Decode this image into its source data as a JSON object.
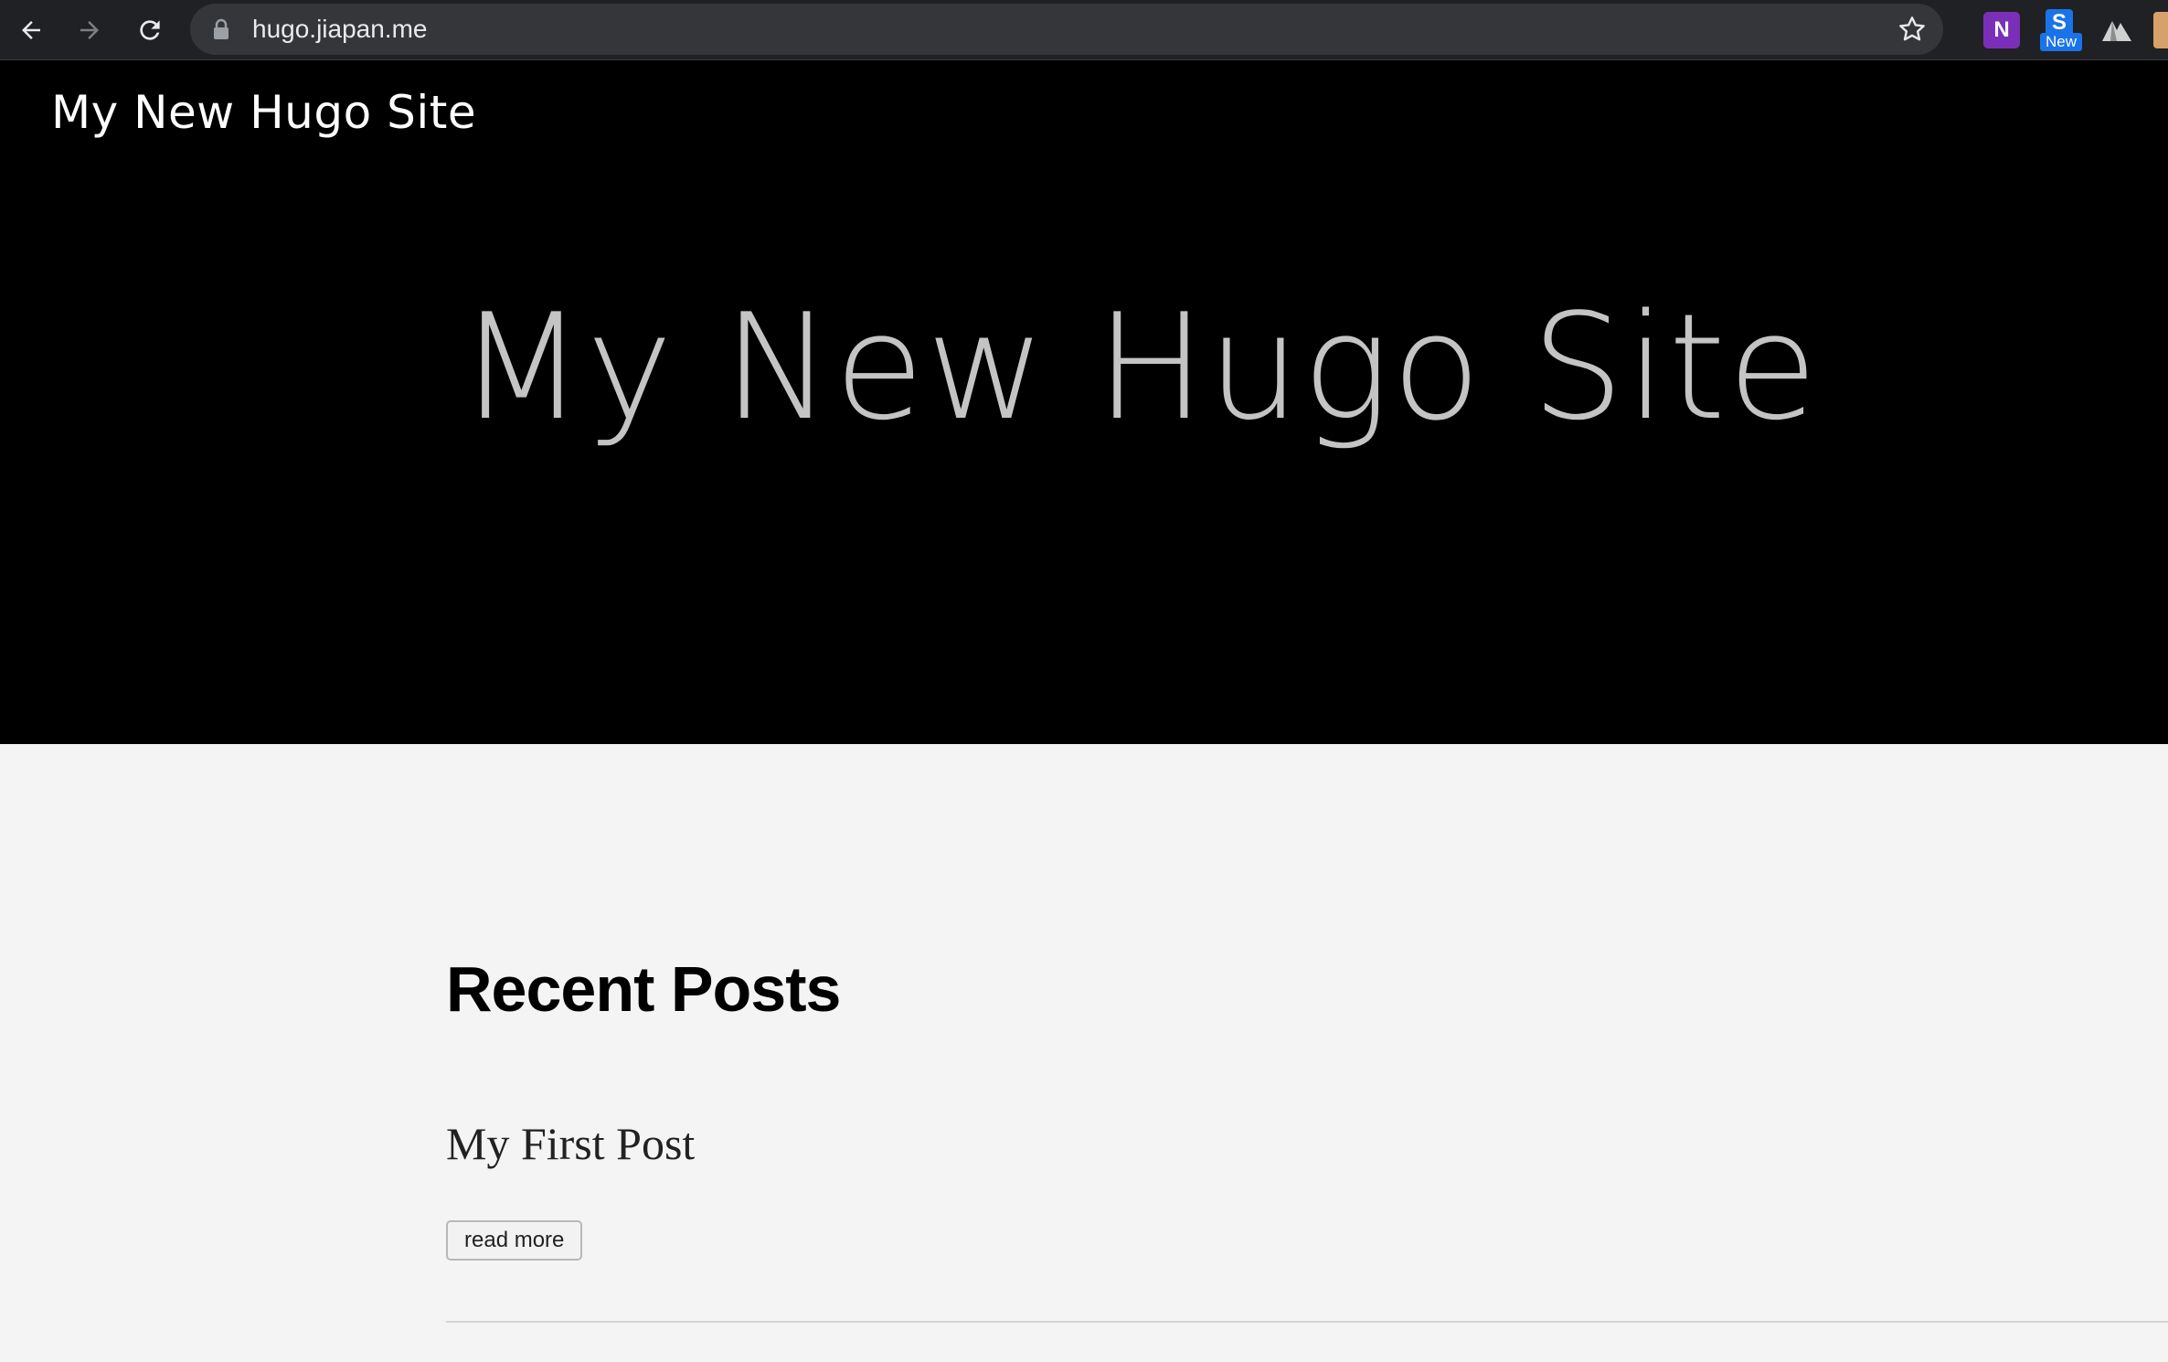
{
  "browser": {
    "url": "hugo.jiapan.me",
    "back_icon": "arrow-left-icon",
    "forward_icon": "arrow-right-icon",
    "reload_icon": "reload-icon",
    "lock_icon": "lock-icon",
    "bookmark_icon": "star-icon",
    "extensions": [
      {
        "name": "onenote-icon",
        "label": "N"
      },
      {
        "name": "s-extension-icon",
        "label": "S",
        "badge": "New"
      },
      {
        "name": "mountain-icon"
      },
      {
        "name": "avatar-extension-icon"
      }
    ]
  },
  "site": {
    "logo": "My New Hugo Site",
    "hero_title": "My New Hugo Site"
  },
  "main": {
    "section_title": "Recent Posts",
    "posts": [
      {
        "title": "My First Post",
        "read_more": "read more"
      }
    ]
  },
  "colors": {
    "chrome_bg": "#202124",
    "omnibox_bg": "#35363a",
    "hero_bg": "#000000",
    "hero_title": "#c4c4c4",
    "page_bg": "#f4f4f4"
  }
}
